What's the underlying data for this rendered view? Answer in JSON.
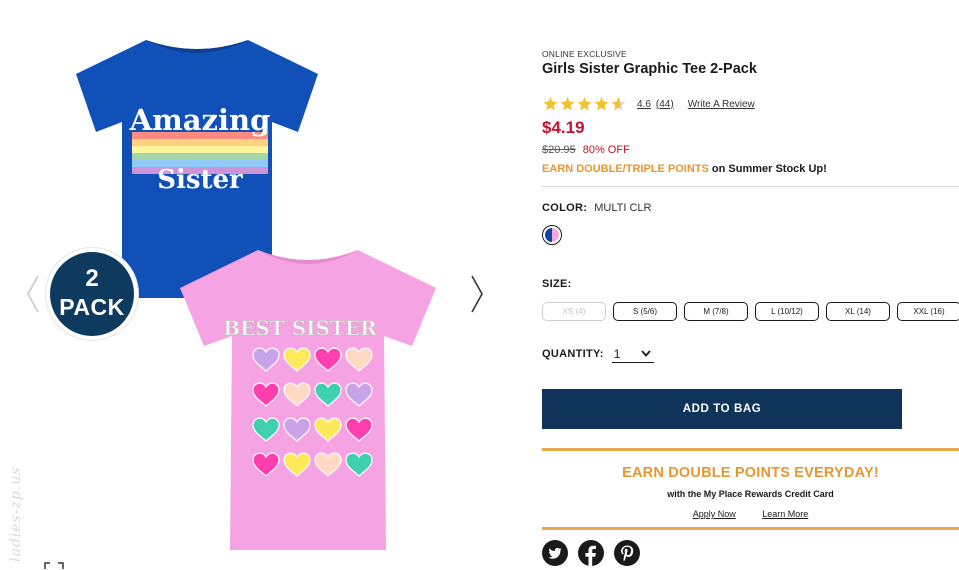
{
  "product": {
    "exclusive_label": "ONLINE EXCLUSIVE",
    "title": "Girls Sister Graphic Tee 2-Pack",
    "rating": {
      "value": "4.6",
      "stars": 4.6,
      "max_stars": 5,
      "count": "(44)",
      "write_review": "Write A Review"
    },
    "price": "$4.19",
    "original_price": "$20.95",
    "discount": "80% OFF",
    "points_promo": {
      "accent": "EARN DOUBLE/TRIPLE POINTS",
      "rest": " on Summer Stock Up!"
    },
    "color": {
      "label": "COLOR:",
      "value": "MULTI CLR"
    },
    "size": {
      "label": "SIZE:",
      "options": [
        {
          "label": "XS (4)",
          "available": false
        },
        {
          "label": "S (5/6)",
          "available": true
        },
        {
          "label": "M (7/8)",
          "available": true
        },
        {
          "label": "L (10/12)",
          "available": true
        },
        {
          "label": "XL (14)",
          "available": true
        },
        {
          "label": "XXL (16)",
          "available": true
        }
      ]
    },
    "quantity": {
      "label": "QUANTITY:",
      "value": "1"
    },
    "add_to_bag": "ADD TO BAG"
  },
  "image": {
    "badge_number": "2",
    "badge_word": "PACK",
    "blue_tee_line1": "Amazing",
    "blue_tee_line2": "Sister",
    "pink_tee_text": "BEST SISTER",
    "watermark": "ladies-zp.us"
  },
  "promo": {
    "headline": "EARN DOUBLE POINTS EVERYDAY!",
    "subtext": "with the My Place Rewards Credit Card",
    "apply_link": "Apply Now",
    "learn_link": "Learn More"
  },
  "colors": {
    "price_red": "#c4112f",
    "accent_orange": "#e8962e",
    "navy_button": "#0f3359",
    "star_gold": "#f2c230"
  },
  "icons": [
    "chevron-left-icon",
    "chevron-right-icon",
    "expand-icon",
    "twitter-icon",
    "facebook-icon",
    "pinterest-icon"
  ]
}
